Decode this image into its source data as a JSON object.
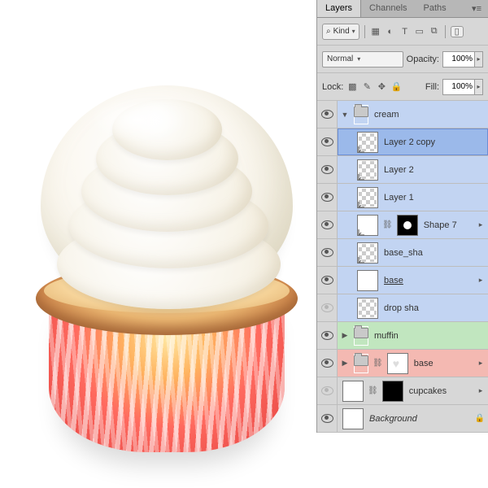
{
  "panel": {
    "tabs": [
      "Layers",
      "Channels",
      "Paths"
    ],
    "filter": {
      "kind": "Kind"
    },
    "blendMode": "Normal",
    "opacity": "100%",
    "fill": "100%",
    "labels": {
      "opacity": "Opacity:",
      "lock": "Lock:",
      "fill": "Fill:"
    }
  },
  "layers": [
    {
      "name": "cream",
      "tint": "blue",
      "visible": true,
      "type": "group",
      "expanded": true,
      "indent": 0,
      "selected": false
    },
    {
      "name": "Layer 2 copy",
      "tint": "blue",
      "visible": true,
      "type": "pixel",
      "thumb": "chk",
      "indent": 1,
      "selected": true,
      "clipped": true
    },
    {
      "name": "Layer 2",
      "tint": "blue",
      "visible": true,
      "type": "pixel",
      "thumb": "chk",
      "indent": 1,
      "selected": false,
      "clipped": true
    },
    {
      "name": "Layer 1",
      "tint": "blue",
      "visible": true,
      "type": "pixel",
      "thumb": "chk",
      "indent": 1,
      "selected": false,
      "clipped": true
    },
    {
      "name": "Shape 7",
      "tint": "blue",
      "visible": true,
      "type": "shape",
      "thumb": "white",
      "mask": "dot",
      "fx": true,
      "indent": 1,
      "selected": false,
      "clipped": true
    },
    {
      "name": "base_sha",
      "tint": "blue",
      "visible": true,
      "type": "pixel",
      "thumb": "chk",
      "indent": 1,
      "selected": false,
      "clipped": true
    },
    {
      "name": "base",
      "tint": "blue",
      "visible": true,
      "type": "pixel",
      "thumb": "white",
      "fx": true,
      "underline": true,
      "indent": 1,
      "selected": false
    },
    {
      "name": "drop sha",
      "tint": "blue",
      "visible": false,
      "type": "pixel",
      "thumb": "chk",
      "indent": 1,
      "selected": false
    },
    {
      "name": "muffin",
      "tint": "green",
      "visible": true,
      "type": "group",
      "expanded": false,
      "indent": 0,
      "selected": false
    },
    {
      "name": "base",
      "tint": "red",
      "visible": true,
      "type": "group",
      "expanded": false,
      "mask": "heart",
      "fx": true,
      "indent": 0,
      "selected": false
    },
    {
      "name": "cupcakes",
      "tint": "none",
      "visible": false,
      "type": "pixel",
      "thumb": "white",
      "mask": "black",
      "fx": true,
      "indent": 0,
      "selected": false
    },
    {
      "name": "Background",
      "tint": "none",
      "visible": true,
      "type": "pixel",
      "thumb": "white",
      "italic": true,
      "locked": true,
      "indent": 0,
      "selected": false
    }
  ]
}
